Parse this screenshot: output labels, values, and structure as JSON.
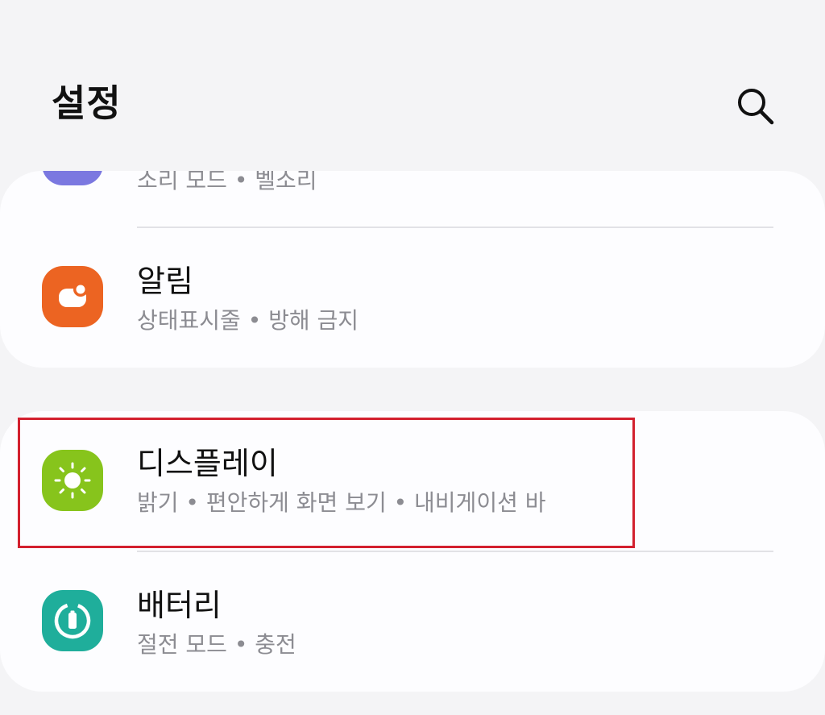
{
  "header": {
    "title": "설정",
    "search_icon": "search-icon"
  },
  "sound_row": {
    "subtitle": "소리 모드 • 벨소리",
    "icon_color": "#7b78e0"
  },
  "notifications_row": {
    "title": "알림",
    "subtitle": "상태표시줄 • 방해 금지",
    "icon": "notification-icon",
    "icon_color": "#ec6422"
  },
  "display_row": {
    "title": "디스플레이",
    "subtitle": "밝기 • 편안하게 화면 보기 • 내비게이션 바",
    "icon": "brightness-icon",
    "icon_color": "#87c41c",
    "highlighted": true,
    "highlight_color": "#d3202e"
  },
  "battery_row": {
    "title": "배터리",
    "subtitle": "절전 모드 • 충전",
    "icon": "battery-icon",
    "icon_color": "#1fae9b"
  }
}
